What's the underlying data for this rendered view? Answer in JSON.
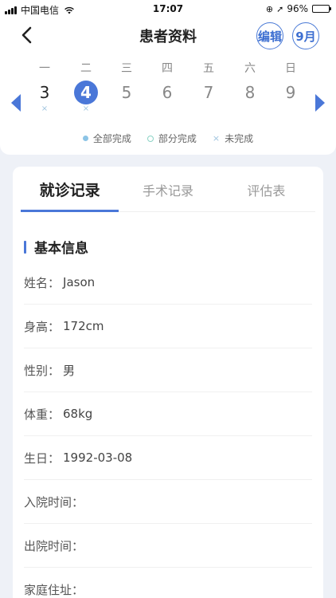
{
  "status_bar": {
    "carrier": "中国电信",
    "time": "17:07",
    "battery": "96%",
    "battery_level": 0.96
  },
  "nav": {
    "title": "患者资料",
    "edit_label": "编辑",
    "month_label": "9月"
  },
  "calendar": {
    "days": [
      {
        "weekday": "一",
        "date": "3",
        "mark": "×"
      },
      {
        "weekday": "二",
        "date": "4",
        "mark": "×"
      },
      {
        "weekday": "三",
        "date": "5",
        "mark": ""
      },
      {
        "weekday": "四",
        "date": "6",
        "mark": ""
      },
      {
        "weekday": "五",
        "date": "7",
        "mark": ""
      },
      {
        "weekday": "六",
        "date": "8",
        "mark": ""
      },
      {
        "weekday": "日",
        "date": "9",
        "mark": ""
      }
    ],
    "selected_date": "4",
    "legend": {
      "full": "全部完成",
      "partial": "部分完成",
      "none": "未完成"
    }
  },
  "tabs": [
    "就诊记录",
    "手术记录",
    "评估表"
  ],
  "active_tab": "就诊记录",
  "section": {
    "title": "基本信息",
    "fields": [
      {
        "label": "姓名：",
        "value": "Jason"
      },
      {
        "label": "身高：",
        "value": "172cm"
      },
      {
        "label": "性别：",
        "value": "男"
      },
      {
        "label": "体重：",
        "value": "68kg"
      },
      {
        "label": "生日：",
        "value": "1992-03-08"
      },
      {
        "label": "入院时间：",
        "value": ""
      },
      {
        "label": "出院时间：",
        "value": ""
      },
      {
        "label": "家庭住址：",
        "value": ""
      }
    ]
  },
  "colors": {
    "accent": "#4a77d8",
    "background": "#eef1f7",
    "mark": "#9fc4de"
  }
}
